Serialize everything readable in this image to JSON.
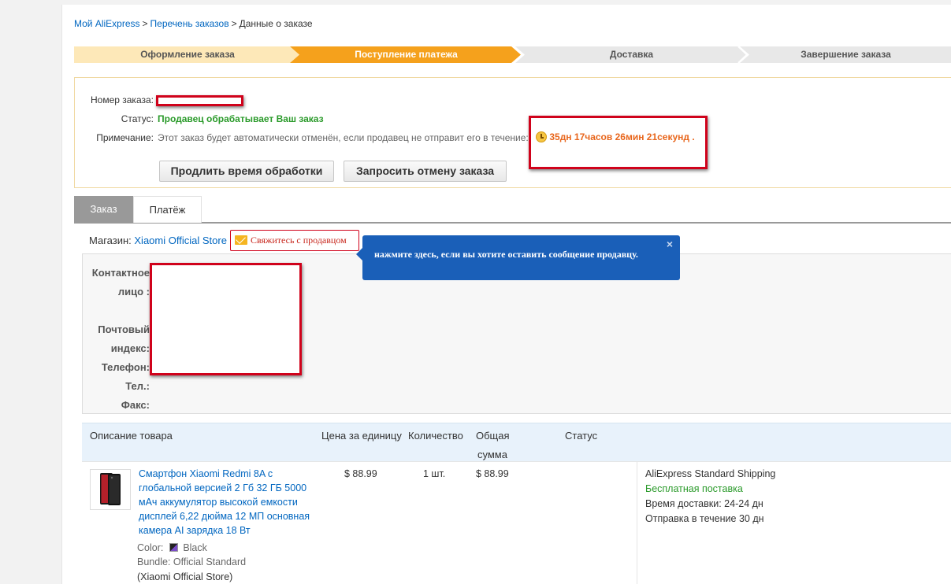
{
  "breadcrumb": {
    "home": "Мой AliExpress",
    "orders": "Перечень заказов",
    "current": "Данные о заказе",
    "separator": ">"
  },
  "steps": [
    {
      "label": "Оформление заказа",
      "state": "done",
      "color": "#fde8b8"
    },
    {
      "label": "Поступление платежа",
      "state": "current",
      "color": "#f5a11c"
    },
    {
      "label": "Доставка",
      "state": "pending",
      "color": "#e8e8e8"
    },
    {
      "label": "Завершение заказа",
      "state": "pending",
      "color": "#e8e8e8"
    }
  ],
  "order_status": {
    "order_number_label": "Номер заказа:",
    "order_number_value": "",
    "status_label": "Статус:",
    "status_value": "Продавец обрабатывает Ваш заказ",
    "note_label": "Примечание:",
    "note_text": "Этот заказ будет автоматически отменён, если продавец не отправит его в течение:",
    "countdown": "35дн 17часов 26мин 21секунд",
    "countdown_suffix": ".",
    "extend_button": "Продлить время обработки",
    "cancel_button": "Запросить отмену заказа"
  },
  "tabs": [
    {
      "label": "Заказ",
      "active": true
    },
    {
      "label": "Платёж",
      "active": false
    }
  ],
  "shop": {
    "label": "Магазин:",
    "name": "Xiaomi Official Store",
    "contact_button": "Свяжитесь с продавцом"
  },
  "tooltip": {
    "text": "нажмите здесь, если вы хотите оставить сообщение продавцу.",
    "close": "×"
  },
  "contact": {
    "person_label_1": "Контактное",
    "person_label_2": "лицо :",
    "zip_label_1": "Почтовый",
    "zip_label_2": "индекс:",
    "phone_label": "Телефон:",
    "tel_label": "Тел.:",
    "fax_label": "Факс:"
  },
  "table": {
    "headers": {
      "description": "Описание товара",
      "unit_price": "Цена за единицу",
      "quantity": "Количество",
      "total_1": "Общая",
      "total_2": "сумма",
      "status": "Статус"
    }
  },
  "product": {
    "title": "Смартфон Xiaomi Redmi 8A с глобальной версией 2 Гб 32 ГБ 5000 мАч аккумулятор высокой емкости дисплей 6,22 дюйма 12 МП основная камера AI зарядка 18 Вт",
    "color_label": "Color:",
    "color_value": "Black",
    "bundle_label": "Bundle:",
    "bundle_value": "Official Standard",
    "store": "(Xiaomi Official Store)",
    "unit_price": "$ 88.99",
    "quantity": "1 шт.",
    "total": "$ 88.99",
    "shipping_method": "AliExpress Standard Shipping",
    "free_shipping": "Бесплатная поставка",
    "delivery_time_label": "Время доставки:",
    "delivery_time_value": "24-24 дн",
    "dispatch_label": "Отправка в течение",
    "dispatch_value": "30 дн"
  },
  "colors": {
    "link": "#0066c0",
    "status_green": "#2a9a2a",
    "countdown_orange": "#e8661c",
    "highlight_red": "#d0021b",
    "tooltip_blue": "#1a5fb8"
  }
}
